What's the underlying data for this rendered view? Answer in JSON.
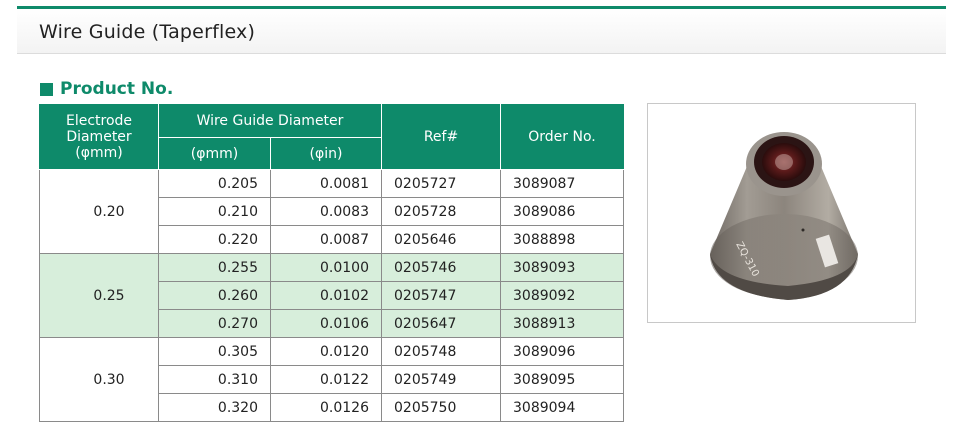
{
  "page": {
    "title": "Wire Guide (Taperflex)"
  },
  "section": {
    "heading": "Product No."
  },
  "table": {
    "headers": {
      "electrode": "Electrode Diameter (φmm)",
      "wire_guide": "Wire Guide Diameter",
      "mm": "(φmm)",
      "in": "(φin)",
      "ref": "Ref#",
      "order": "Order No."
    },
    "groups": [
      {
        "electrode": "0.20",
        "highlight": false,
        "rows": [
          {
            "mm": "0.205",
            "in": "0.0081",
            "ref": "0205727",
            "order": "3089087"
          },
          {
            "mm": "0.210",
            "in": "0.0083",
            "ref": "0205728",
            "order": "3089086"
          },
          {
            "mm": "0.220",
            "in": "0.0087",
            "ref": "0205646",
            "order": "3088898"
          }
        ]
      },
      {
        "electrode": "0.25",
        "highlight": true,
        "rows": [
          {
            "mm": "0.255",
            "in": "0.0100",
            "ref": "0205746",
            "order": "3089093"
          },
          {
            "mm": "0.260",
            "in": "0.0102",
            "ref": "0205747",
            "order": "3089092"
          },
          {
            "mm": "0.270",
            "in": "0.0106",
            "ref": "0205647",
            "order": "3088913"
          }
        ]
      },
      {
        "electrode": "0.30",
        "highlight": false,
        "rows": [
          {
            "mm": "0.305",
            "in": "0.0120",
            "ref": "0205748",
            "order": "3089096"
          },
          {
            "mm": "0.310",
            "in": "0.0122",
            "ref": "0205749",
            "order": "3089095"
          },
          {
            "mm": "0.320",
            "in": "0.0126",
            "ref": "0205750",
            "order": "3089094"
          }
        ]
      }
    ]
  },
  "product_image": {
    "engraving": "ZQ-310"
  },
  "colors": {
    "accent": "#0e8a6a",
    "highlight_row": "#d7eedb",
    "text": "#222222"
  }
}
